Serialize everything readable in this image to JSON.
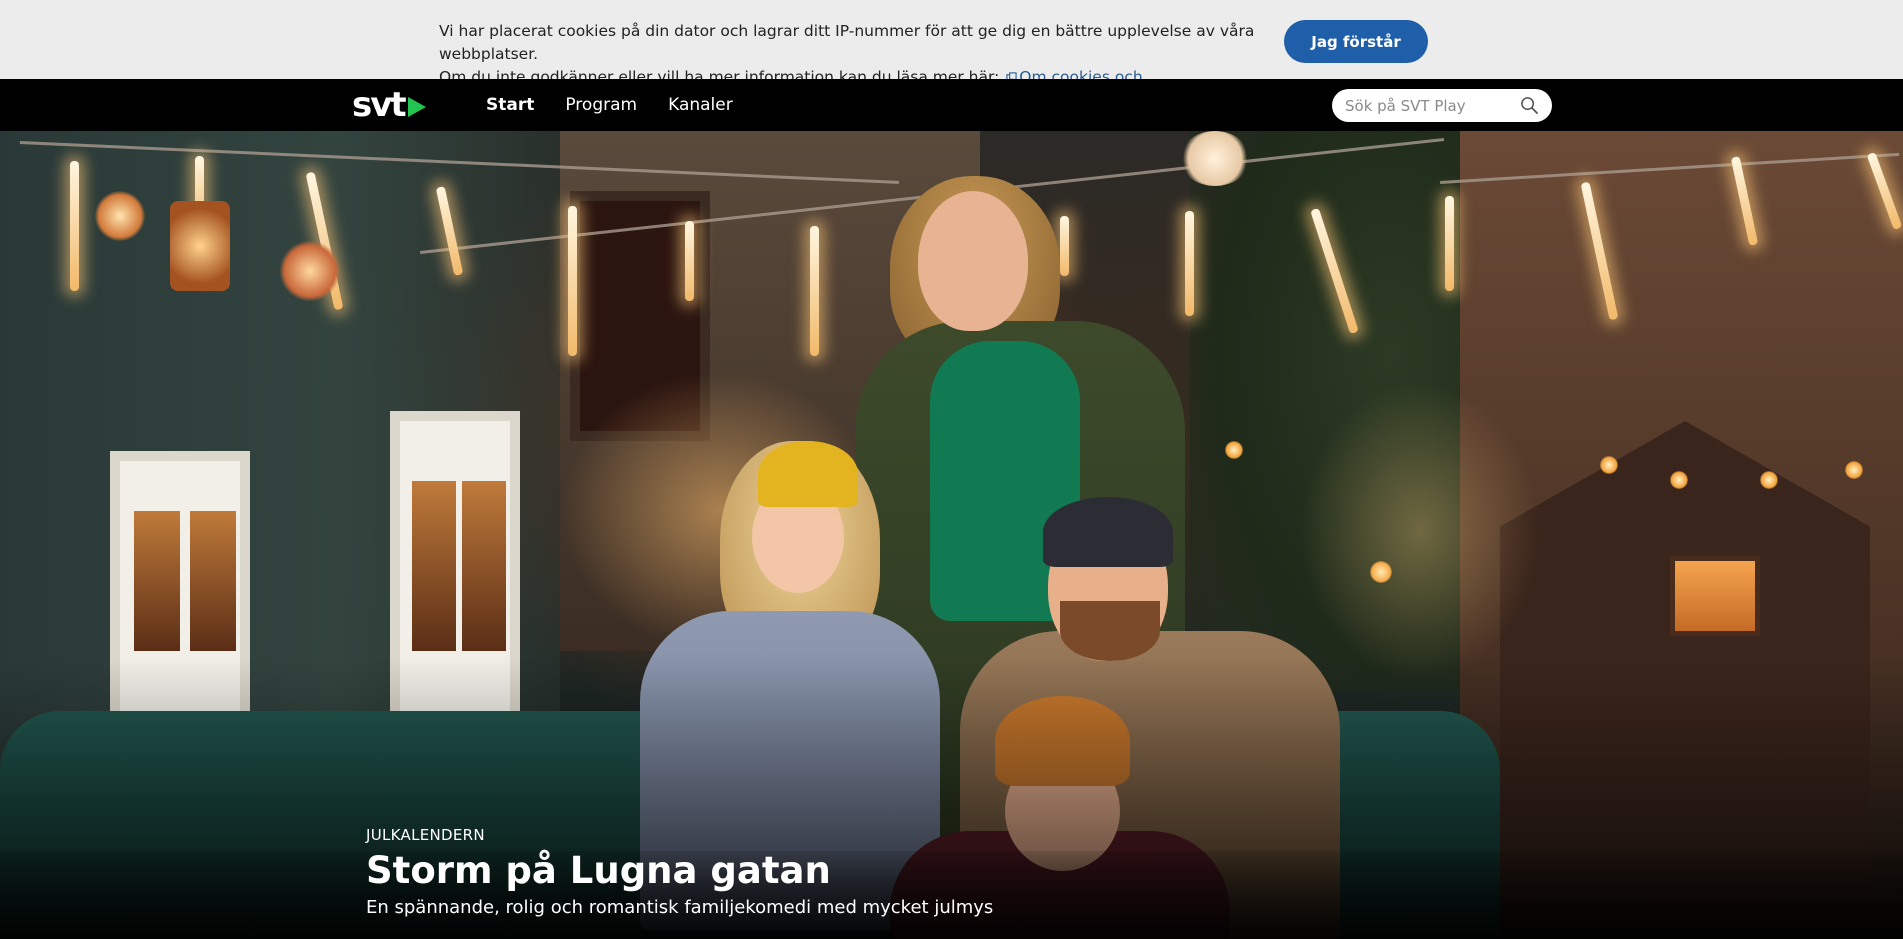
{
  "cookie_banner": {
    "line1": "Vi har placerat cookies på din dator och lagrar ditt IP-nummer för att ge dig en bättre upplevelse av våra webbplatser.",
    "line2": "Om du inte godkänner eller vill ha mer information kan du läsa mer här:",
    "link_label": "Om cookies och personuppgifter",
    "accept_label": "Jag förstår",
    "accent_color": "#1f5ea8"
  },
  "header": {
    "logo_text": "svt",
    "logo_accent_color": "#23c552",
    "nav": [
      {
        "label": "Start",
        "active": true
      },
      {
        "label": "Program",
        "active": false
      },
      {
        "label": "Kanaler",
        "active": false
      }
    ],
    "search": {
      "placeholder": "Sök på SVT Play",
      "icon": "search-icon"
    }
  },
  "hero": {
    "kicker": "JULKALENDERN",
    "title": "Storm på Lugna gatan",
    "description": "En spännande, rolig och romantisk familjekomedi med mycket julmys"
  }
}
